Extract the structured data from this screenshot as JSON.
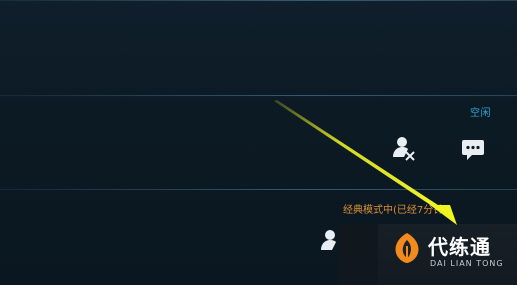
{
  "friend_list": {
    "row1": {
      "status": "空闲",
      "status_color": "#2fa8d8",
      "actions": [
        {
          "icon": "remove-friend-icon"
        },
        {
          "icon": "chat-icon"
        }
      ]
    },
    "row2": {
      "status": "经典模式中(已经7分钟)",
      "status_color": "#d98f35",
      "actions": [
        {
          "icon": "remove-friend-icon"
        }
      ]
    }
  },
  "annotation": {
    "arrow_color": "#e8f020"
  },
  "watermark": {
    "title": "代练通",
    "subtitle": "DAI LIAN TONG",
    "logo_color": "#f28a1e"
  }
}
